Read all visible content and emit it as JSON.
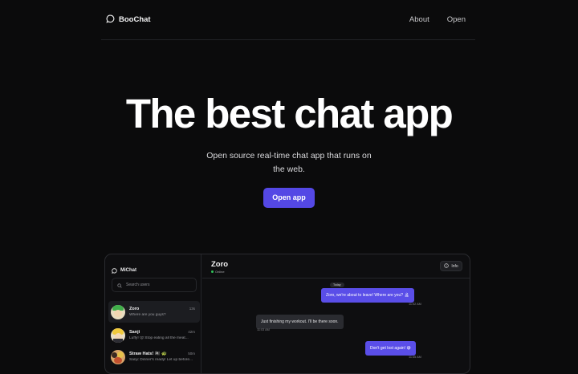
{
  "nav": {
    "brand": "BooChat",
    "links": [
      "About",
      "Open"
    ]
  },
  "hero": {
    "title": "The best chat app",
    "subtitle": "Open source real-time chat app that runs on the web.",
    "cta_label": "Open app"
  },
  "preview": {
    "sidebar": {
      "title": "MiChat",
      "search_placeholder": "Search users",
      "chats": [
        {
          "name": "Zoro",
          "time": "13s",
          "message": "Where are you guys?",
          "active": true
        },
        {
          "name": "Sanji",
          "time": "42m",
          "message": "Luffy! 😡 Stop eating all the meat...",
          "active": false
        },
        {
          "name": "Straw Hats! 🏴‍☠️ 🐢",
          "time": "50m",
          "message": "Sanji: Dinner's ready! Let up before...",
          "active": false
        }
      ]
    },
    "conversation": {
      "name": "Zoro",
      "status": "Online",
      "info_label": "Info",
      "day_label": "Today",
      "messages": [
        {
          "direction": "out",
          "text": "Zoro, we're about to leave! Where are you? 🏝",
          "time": "11:02 AM"
        },
        {
          "direction": "in",
          "text": "Just finishing my workout. I'll be there soon.",
          "time": "11:03 AM"
        },
        {
          "direction": "out",
          "text": "Don't get lost again! 😅",
          "time": "11:45 AM"
        }
      ]
    }
  },
  "colors": {
    "background": "#0b0b0c",
    "accent": "#5448e5",
    "online": "#32c25a"
  }
}
